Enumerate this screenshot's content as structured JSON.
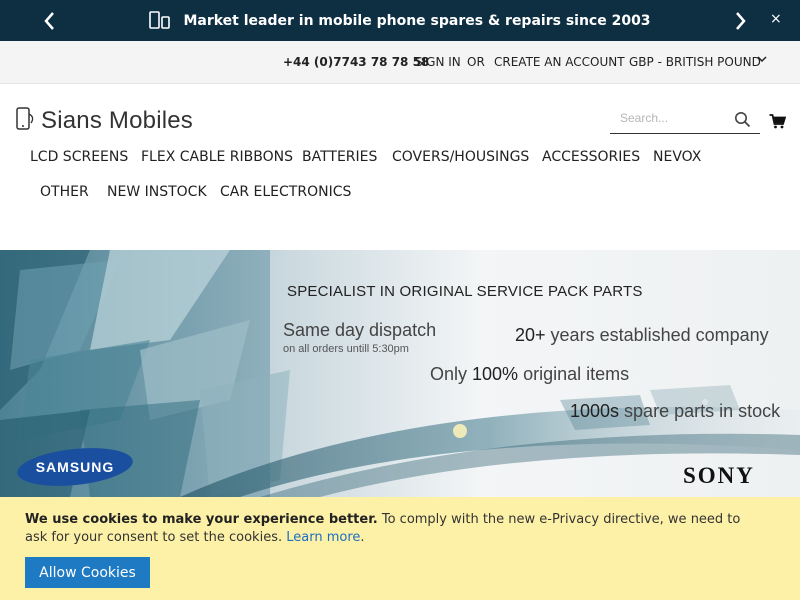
{
  "promo": {
    "message": "Market leader in mobile phone spares & repairs since 2003",
    "close": "×",
    "icons": [
      "phone-tablet-icon",
      "chevron-left-icon",
      "chevron-right-icon",
      "close-icon"
    ]
  },
  "account": {
    "phone": "+44 (0)7743 78 78 58",
    "sign_in": "SIGN IN",
    "or": "OR",
    "create_account": "CREATE AN ACCOUNT",
    "currency": "GBP - BRITISH POUND"
  },
  "header": {
    "logo_text": "Sians Mobiles",
    "search_placeholder": "Search...",
    "icons": [
      "search-icon",
      "cart-icon"
    ]
  },
  "nav": {
    "items": [
      "LCD SCREENS",
      "FLEX CABLE RIBBONS",
      "BATTERIES",
      "COVERS/HOUSINGS",
      "ACCESSORIES",
      "NEVOX",
      "OTHER",
      "NEW INSTOCK",
      "CAR ELECTRONICS"
    ]
  },
  "banner": {
    "headline": "SPECIALIST IN ORIGINAL SERVICE PACK PARTS",
    "same_day": "Same day dispatch",
    "orders_until": "on all orders untill 5:30pm",
    "years_strong": "20+",
    "years_rest": " years established company",
    "original_pre": "Only ",
    "original_strong": "100%",
    "original_rest": " original items",
    "parts_strong": "1000s",
    "parts_rest": " spare parts in stock",
    "brand_left": "SAMSUNG",
    "brand_right": "SONY"
  },
  "cookie": {
    "lead": "We use cookies to make your experience better.",
    "body": " To comply with the new e-Privacy directive, we need to ask for your consent to set the cookies. ",
    "learn_more": "Learn more",
    "end": ".",
    "button": "Allow Cookies"
  },
  "colors": {
    "promo_bg": "#0e2f42",
    "cookie_bg": "#fdf1a8",
    "button_bg": "#1f7ac4",
    "samsung_blue": "#1a4fa0"
  }
}
